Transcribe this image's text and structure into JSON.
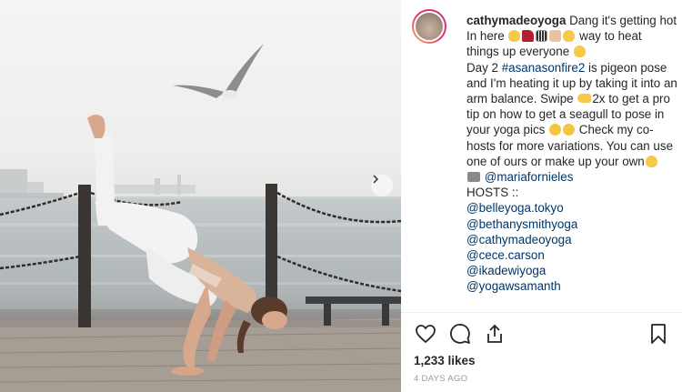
{
  "post": {
    "username": "cathymadeoyoga",
    "caption_open": " Dang it's getting hot In here",
    "caption_way": " way to heat things up everyone",
    "caption_day": "Day 2 ",
    "hashtag": "#asanasonfire2",
    "caption_pose": " is pigeon pose and I'm heating it up by taking it into an arm balance. Swipe",
    "caption_swipe": "2x to get a pro tip on how to get a seagull to pose in your yoga pics",
    "caption_check": " Check my co-hosts for more variations. You can use one of ours or make up your own",
    "photo_credit": "@mariafornieles",
    "hosts_label": "HOSTS ::",
    "hosts": [
      "@belleyoga.tokyo",
      "@bethanysmithyoga",
      "@cathymadeoyoga",
      "@cece.carson",
      "@ikadewiyoga",
      "@yogawsamanth"
    ],
    "likes": "1,233 likes",
    "timestamp": "4 DAYS AGO"
  },
  "icons": {
    "like": "heart-icon",
    "comment": "comment-icon",
    "share": "share-icon",
    "save": "bookmark-icon",
    "next": "chevron-right-icon"
  },
  "colors": {
    "text": "#262626",
    "link": "#003569",
    "muted": "#999999",
    "story_ring_start": "#fdb35c",
    "story_ring_end": "#c13584"
  }
}
